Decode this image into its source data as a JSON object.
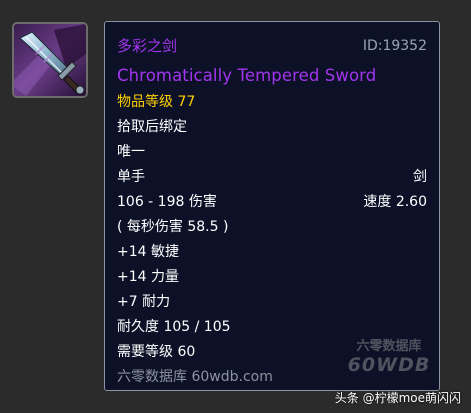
{
  "item": {
    "name_cn": "多彩之剑",
    "id_text": "ID:19352",
    "name_en": "Chromatically Tempered Sword",
    "item_level": "物品等级 77",
    "binding": "拾取后绑定",
    "unique": "唯一",
    "slot": "单手",
    "weapon_type": "剑",
    "damage": "106 - 198 伤害",
    "speed": "速度 2.60",
    "dps": "( 每秒伤害 58.5 )",
    "stats": [
      "+14 敏捷",
      "+14 力量",
      "+7 耐力"
    ],
    "durability": "耐久度 105 / 105",
    "required_level": "需要等级 60",
    "source": "六零数据库 60wdb.com"
  },
  "icon": "purple-sword-icon",
  "watermark": {
    "cn": "六零数据库",
    "en": "60WDB"
  },
  "credit": "头条 @柠檬moe萌闪闪",
  "colors": {
    "epic": "#a335ee",
    "item_level": "#ffd100",
    "tooltip_bg": "#0c1128",
    "tooltip_border": "#8c95a3",
    "page_bg": "#2b2b2b"
  }
}
